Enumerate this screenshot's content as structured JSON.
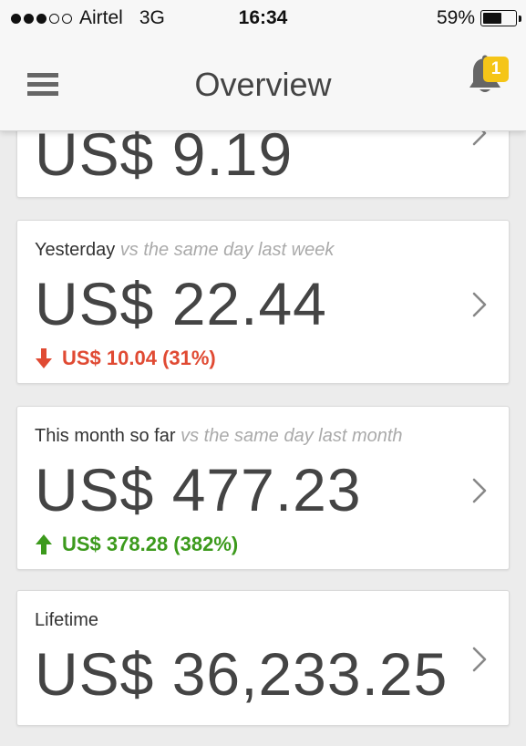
{
  "status_bar": {
    "signal_filled": 3,
    "signal_total": 5,
    "carrier": "Airtel",
    "network": "3G",
    "time": "16:34",
    "battery": "59%",
    "battery_level": 0.59
  },
  "header": {
    "title": "Overview",
    "menu_icon": "hamburger-menu-icon",
    "notification_icon": "bell-icon",
    "notification_count": "1",
    "badge_color": "#f5c518"
  },
  "cards": {
    "partial": {
      "value": "US$ 9.19"
    },
    "yesterday": {
      "label": "Yesterday",
      "comparison": "vs the same day last week",
      "value": "US$ 22.44",
      "delta": "US$ 10.04 (31%)",
      "direction": "down",
      "color": "#e04a33"
    },
    "this_month": {
      "label": "This month so far",
      "comparison": "vs the same day last month",
      "value": "US$ 477.23",
      "delta": "US$ 378.28 (382%)",
      "direction": "up",
      "color": "#3c9a1c"
    },
    "lifetime": {
      "label": "Lifetime",
      "value": "US$ 36,233.25"
    }
  }
}
